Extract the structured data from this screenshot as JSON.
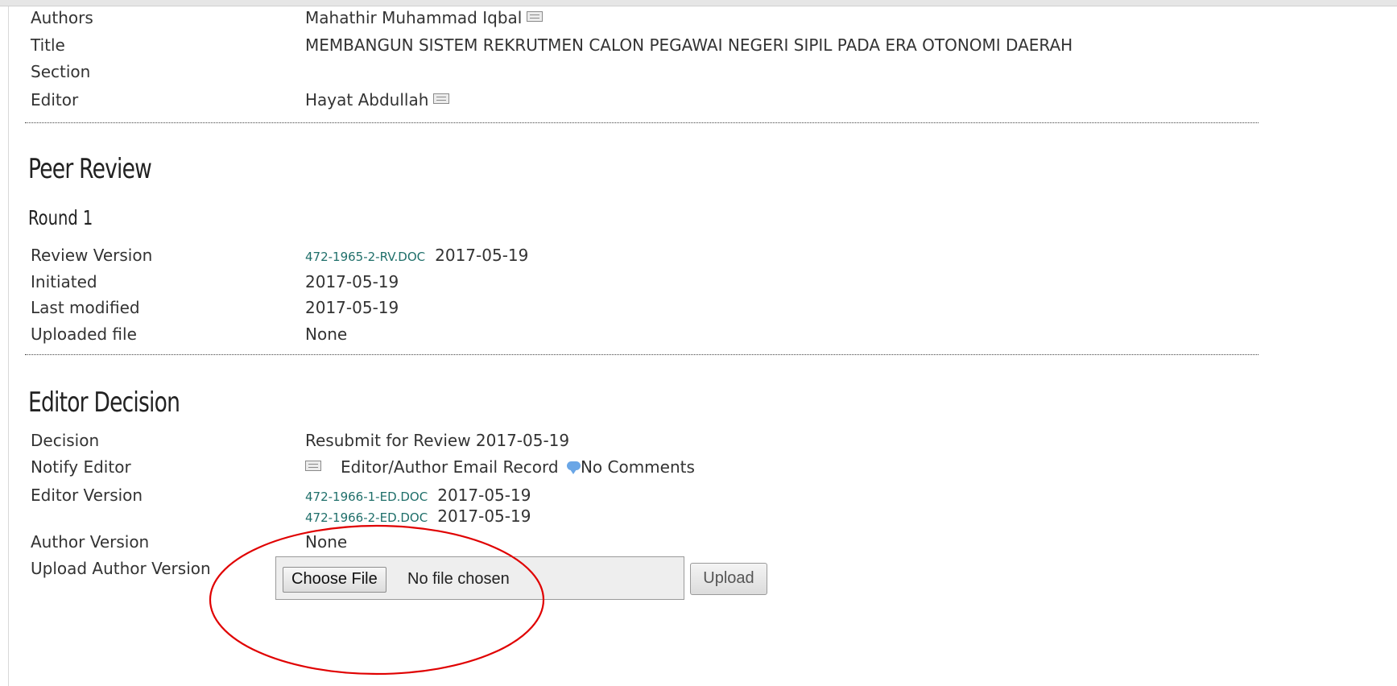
{
  "summary": {
    "authors_label": "Authors",
    "authors_value": "Mahathir Muhammad Iqbal",
    "title_label": "Title",
    "title_value": "MEMBANGUN SISTEM REKRUTMEN CALON PEGAWAI NEGERI SIPIL PADA ERA OTONOMI DAERAH",
    "section_label": "Section",
    "section_value": "",
    "editor_label": "Editor",
    "editor_value": "Hayat Abdullah"
  },
  "peer_review": {
    "heading": "Peer Review",
    "round_heading": "Round 1",
    "review_version_label": "Review Version",
    "review_version_file": "472-1965-2-RV.DOC",
    "review_version_date": "2017-05-19",
    "initiated_label": "Initiated",
    "initiated_value": "2017-05-19",
    "last_modified_label": "Last modified",
    "last_modified_value": "2017-05-19",
    "uploaded_file_label": "Uploaded file",
    "uploaded_file_value": "None"
  },
  "editor_decision": {
    "heading": "Editor Decision",
    "decision_label": "Decision",
    "decision_value": "Resubmit for Review 2017-05-19",
    "notify_label": "Notify Editor",
    "email_record_text": "Editor/Author Email Record",
    "comments_text": "No Comments",
    "editor_version_label": "Editor Version",
    "editor_versions": [
      {
        "file": "472-1966-1-ED.DOC",
        "date": "2017-05-19"
      },
      {
        "file": "472-1966-2-ED.DOC",
        "date": "2017-05-19"
      }
    ],
    "author_version_label": "Author Version",
    "author_version_value": "None",
    "upload_author_label": "Upload Author Version",
    "choose_file_label": "Choose File",
    "no_file_text": "No file chosen",
    "upload_button_label": "Upload"
  },
  "colors": {
    "link": "#1f6f6a",
    "annotation": "#e00000"
  },
  "icons": [
    "mail-icon",
    "comment-icon"
  ]
}
